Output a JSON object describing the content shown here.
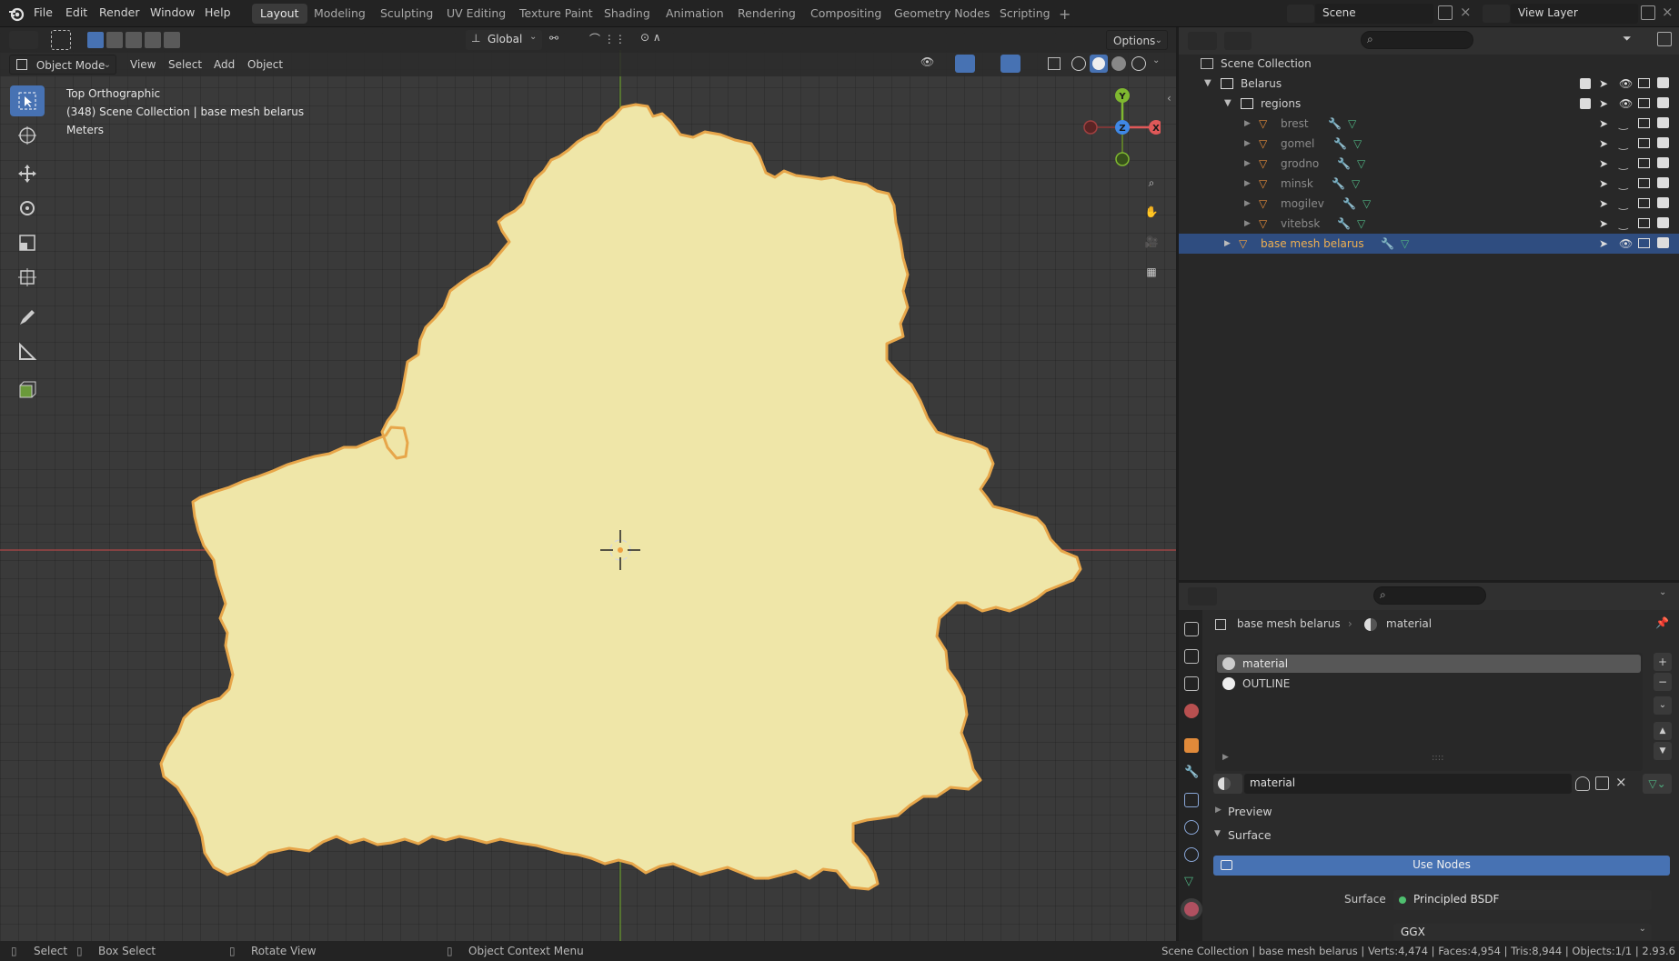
{
  "menu": {
    "file": "File",
    "edit": "Edit",
    "render": "Render",
    "window": "Window",
    "help": "Help"
  },
  "workspaces": [
    "Layout",
    "Modeling",
    "Sculpting",
    "UV Editing",
    "Texture Paint",
    "Shading",
    "Animation",
    "Rendering",
    "Compositing",
    "Geometry Nodes",
    "Scripting"
  ],
  "active_workspace": "Layout",
  "scene": {
    "name": "Scene",
    "view_layer": "View Layer"
  },
  "viewport": {
    "orientation": "Global",
    "options_label": "Options",
    "mode": "Object Mode",
    "menus": {
      "view": "View",
      "select": "Select",
      "add": "Add",
      "object": "Object"
    },
    "overlay_text": {
      "line1": "Top Orthographic",
      "line2": "(348) Scene Collection | base mesh belarus",
      "line3": "Meters"
    },
    "gizmo": {
      "y": "Y",
      "z": "Z",
      "x": "X"
    }
  },
  "outliner": {
    "scene_collection": "Scene Collection",
    "collection": "Belarus",
    "subcollection": "regions",
    "regions": [
      "brest",
      "gomel",
      "grodno",
      "minsk",
      "mogilev",
      "vitebsk"
    ],
    "selected_object": "base mesh belarus"
  },
  "properties": {
    "object_name": "base mesh belarus",
    "material_name": "material",
    "slots": [
      "material",
      "OUTLINE"
    ],
    "material_field": "material",
    "preview_label": "Preview",
    "surface_label": "Surface",
    "use_nodes_label": "Use Nodes",
    "surface_field_label": "Surface",
    "surface_shader": "Principled BSDF",
    "distribution": "GGX"
  },
  "status": {
    "select": "Select",
    "box_select": "Box Select",
    "rotate_view": "Rotate View",
    "context_menu": "Object Context Menu",
    "stats": "Scene Collection | base mesh belarus | Verts:4,474 | Faces:4,954 | Tris:8,944 | Objects:1/1 | 2.93.6"
  },
  "colors": {
    "mesh_fill": "#efe6a8",
    "mesh_outline": "#e7a64a",
    "selection": "#4772b3",
    "x_axis": "#e05858",
    "y_axis": "#7fb830",
    "z_axis": "#3f88e6"
  }
}
